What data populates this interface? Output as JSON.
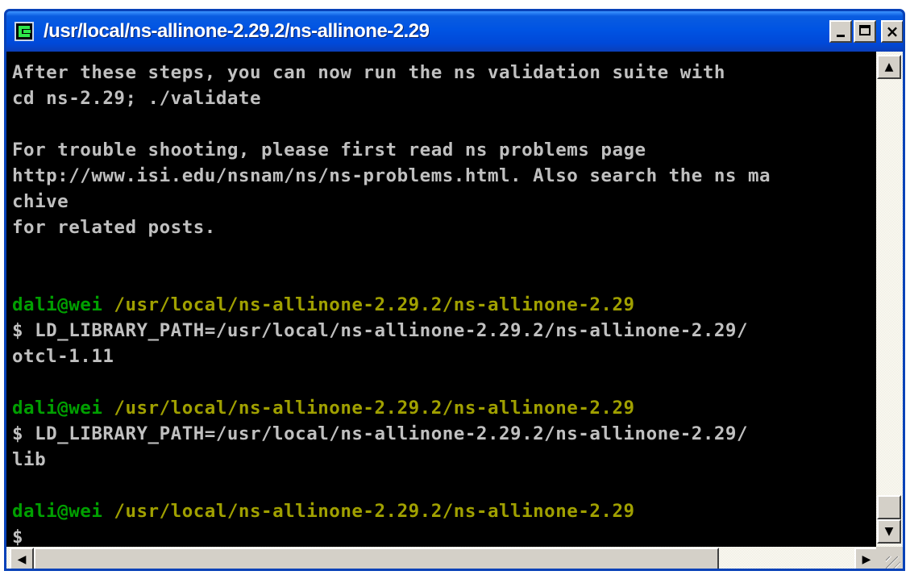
{
  "window": {
    "title": "/usr/local/ns-allinone-2.29.2/ns-allinone-2.29",
    "minimize_label": "_",
    "maximize_label": "□",
    "close_label": "×"
  },
  "terminal": {
    "lines": [
      [
        {
          "text": "After these steps, you can now run the ns validation suite with",
          "color": "default"
        }
      ],
      [
        {
          "text": "cd ns-2.29; ./validate",
          "color": "default"
        }
      ],
      [],
      [
        {
          "text": "For trouble shooting, please first read ns problems page",
          "color": "default"
        }
      ],
      [
        {
          "text": "http://www.isi.edu/nsnam/ns/ns-problems.html. Also search the ns ma",
          "color": "default"
        }
      ],
      [
        {
          "text": "chive",
          "color": "default"
        }
      ],
      [
        {
          "text": "for related posts.",
          "color": "default"
        }
      ],
      [],
      [],
      [
        {
          "text": "dali@wei",
          "color": "green"
        },
        {
          "text": " /usr/local/ns-allinone-2.29.2/ns-allinone-2.29",
          "color": "yellow"
        }
      ],
      [
        {
          "text": "$ LD_LIBRARY_PATH=/usr/local/ns-allinone-2.29.2/ns-allinone-2.29/",
          "color": "default"
        }
      ],
      [
        {
          "text": "otcl-1.11",
          "color": "default"
        }
      ],
      [],
      [
        {
          "text": "dali@wei",
          "color": "green"
        },
        {
          "text": " /usr/local/ns-allinone-2.29.2/ns-allinone-2.29",
          "color": "yellow"
        }
      ],
      [
        {
          "text": "$ LD_LIBRARY_PATH=/usr/local/ns-allinone-2.29.2/ns-allinone-2.29/",
          "color": "default"
        }
      ],
      [
        {
          "text": "lib",
          "color": "default"
        }
      ],
      [],
      [
        {
          "text": "dali@wei",
          "color": "green"
        },
        {
          "text": " /usr/local/ns-allinone-2.29.2/ns-allinone-2.29",
          "color": "yellow"
        }
      ],
      [
        {
          "text": "$",
          "color": "default"
        }
      ]
    ]
  },
  "colors": {
    "titlebar": "#0054e3",
    "console_bg": "#000000",
    "console_text": "#c0c0c0",
    "prompt_user": "#00a000",
    "prompt_path": "#a0a000"
  },
  "icons": {
    "app": "cygwin-terminal-icon",
    "scroll_up": "arrow-up-icon",
    "scroll_down": "arrow-down-icon",
    "scroll_left": "arrow-left-icon",
    "scroll_right": "arrow-right-icon"
  }
}
